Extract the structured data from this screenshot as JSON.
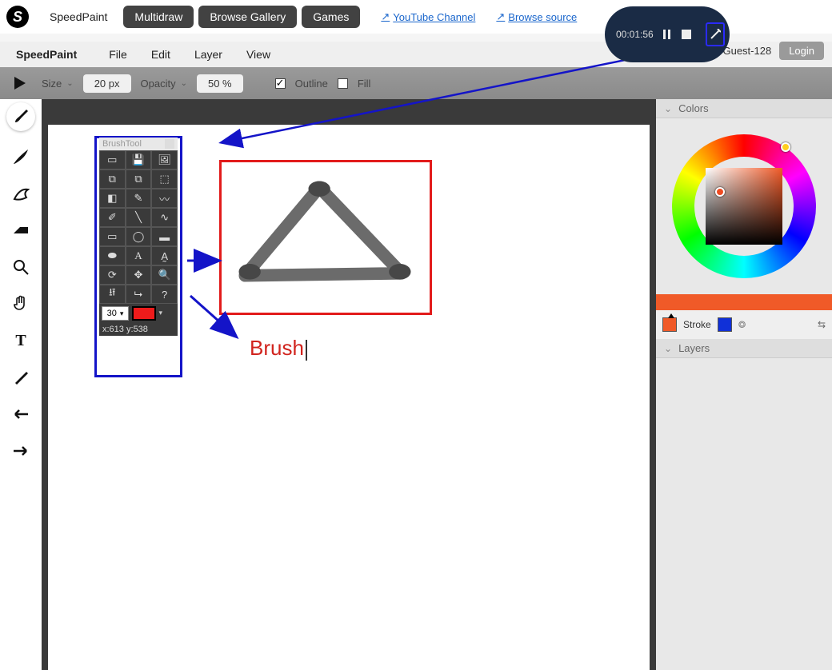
{
  "nav": {
    "tabs": [
      "SpeedPaint",
      "Multidraw",
      "Browse Gallery",
      "Games"
    ],
    "links": {
      "yt": "YouTube Channel",
      "src": "Browse source"
    }
  },
  "recorder": {
    "time": "00:01:56"
  },
  "user": {
    "greeting": "Hi Guest-128",
    "login": "Login"
  },
  "menu": {
    "app": "SpeedPaint",
    "items": [
      "File",
      "Edit",
      "Layer",
      "View"
    ]
  },
  "opts": {
    "size_label": "Size",
    "size_val": "20 px",
    "opacity_label": "Opacity",
    "opacity_val": "50 %",
    "outline": "Outline",
    "fill": "Fill"
  },
  "btpanel": {
    "title": "BrushTool",
    "num": "30",
    "coords": "x:613  y:538"
  },
  "canvas_text": "Brush",
  "rp": {
    "colors": "Colors",
    "stroke": "Stroke",
    "layers": "Layers",
    "stroke_color": "#1030d8",
    "fill_color": "#f05a28"
  }
}
